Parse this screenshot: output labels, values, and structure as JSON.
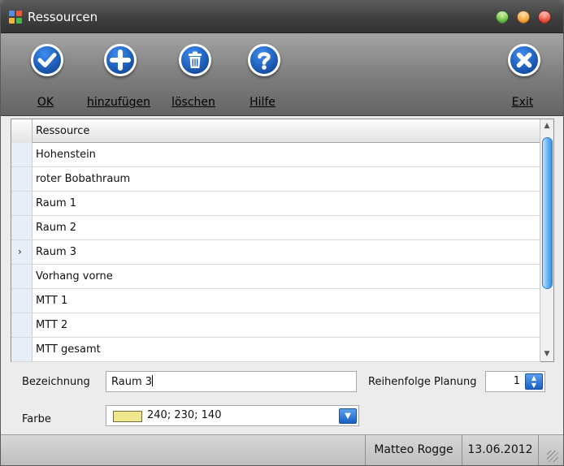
{
  "window": {
    "title": "Ressourcen",
    "app_icon_colors": [
      "#4f8fe6",
      "#e35b3c",
      "#f0b63a",
      "#4fb64a"
    ]
  },
  "toolbar": {
    "ok": {
      "label": "OK",
      "icon": "check-icon"
    },
    "add": {
      "label": "hinzufügen",
      "icon": "plus-icon"
    },
    "delete": {
      "label": "löschen",
      "icon": "trash-icon"
    },
    "help": {
      "label": "Hilfe",
      "icon": "question-icon"
    },
    "exit": {
      "label": "Exit",
      "icon": "close-icon"
    }
  },
  "grid": {
    "column_header": "Ressource",
    "selected_index": 4,
    "current_row_marker": "›",
    "rows": [
      "Hohenstein",
      "roter Bobathraum",
      "Raum 1",
      "Raum 2",
      "Raum 3",
      "Vorhang vorne",
      "MTT 1",
      "MTT 2",
      "MTT gesamt"
    ]
  },
  "form": {
    "name_label": "Bezeichnung",
    "name_value": "Raum 3",
    "order_label": "Reihenfolge Planung",
    "order_value": "1",
    "color_label": "Farbe",
    "color_value": "240; 230; 140",
    "color_swatch": "#F0E68C"
  },
  "status": {
    "user": "Matteo Rogge",
    "date": "13.06.2012"
  }
}
